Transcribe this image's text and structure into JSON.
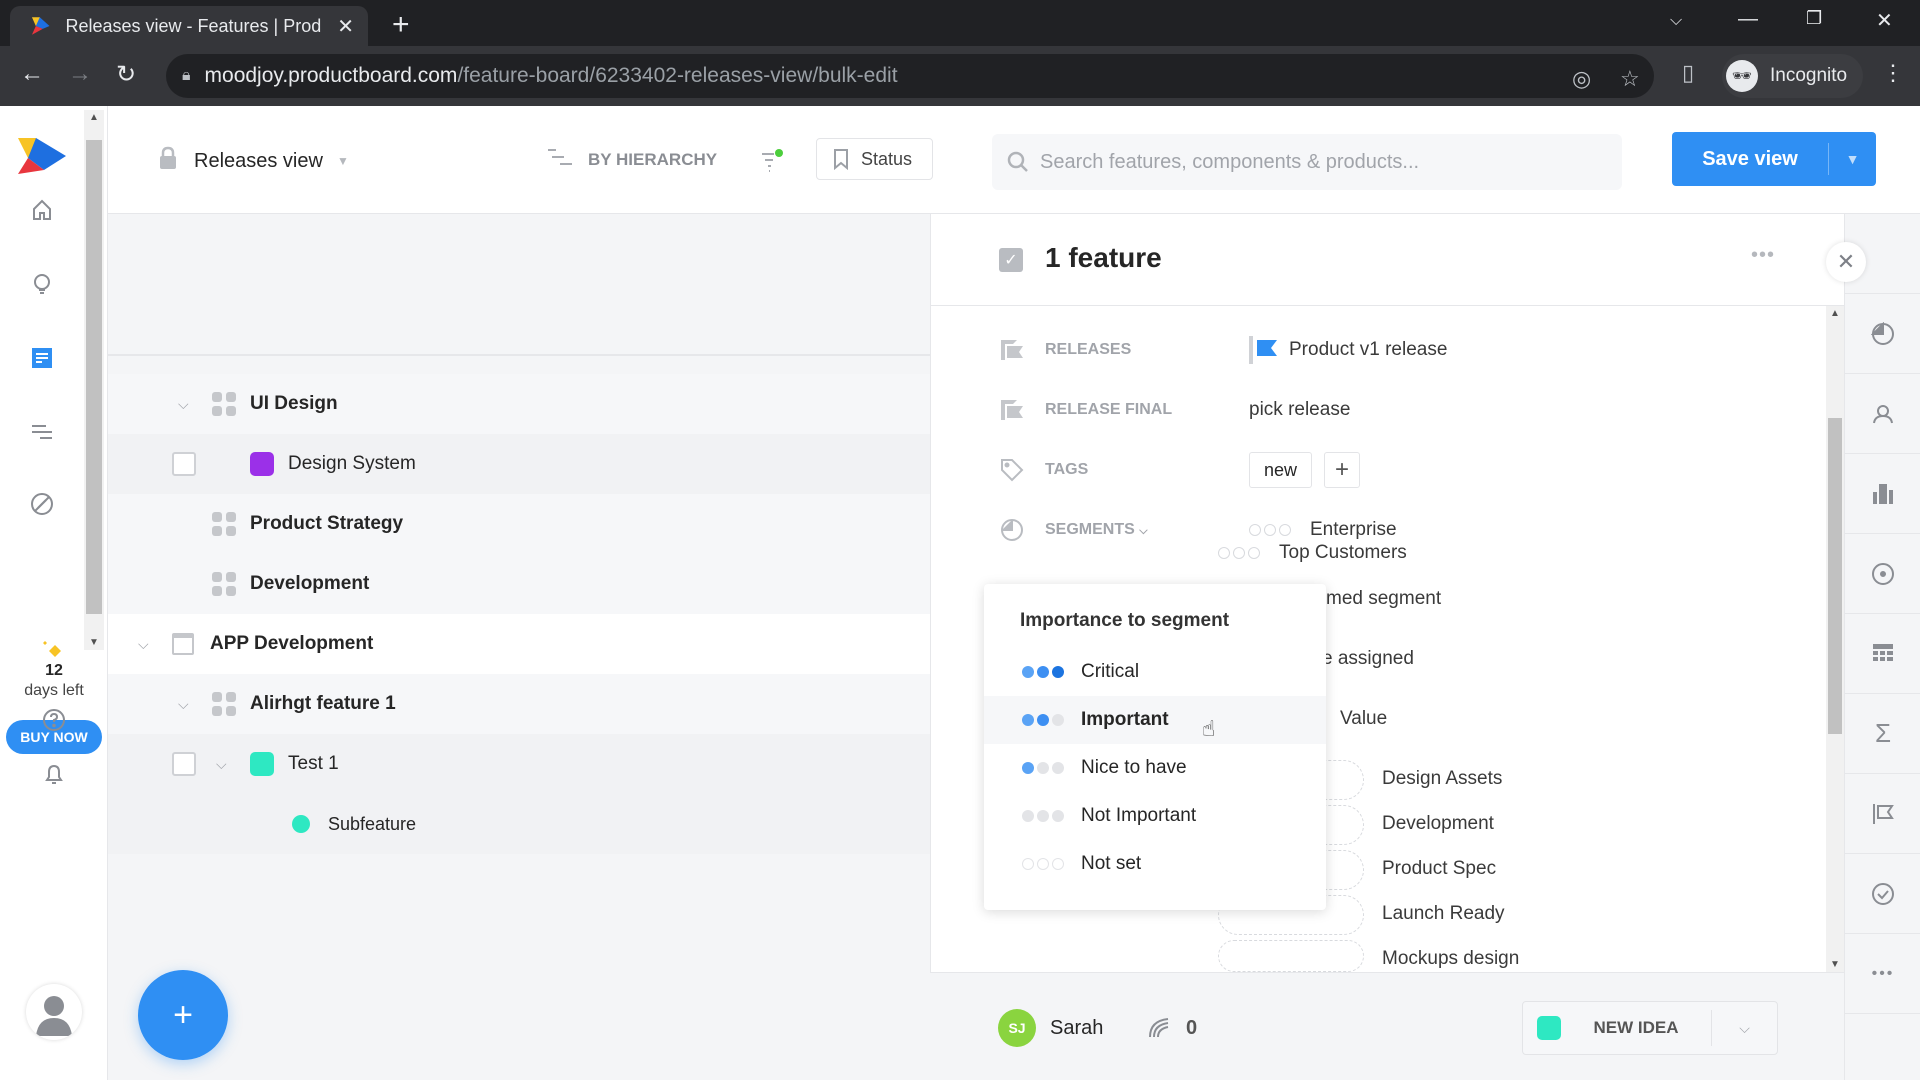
{
  "browser": {
    "tab_title": "Releases view - Features | Productboard",
    "url_host": "moodjoy.productboard.com",
    "url_path": "/feature-board/6233402-releases-view/bulk-edit",
    "profile_label": "Incognito"
  },
  "rail": {
    "trial_days": "12",
    "trial_label": "days left",
    "buy_now": "BUY NOW"
  },
  "appbar": {
    "view_name": "Releases view",
    "grouping": "BY HIERARCHY",
    "status_button": "Status",
    "search_placeholder": "Search features, components & products...",
    "save_view": "Save view"
  },
  "tree": {
    "rows": [
      {
        "label": "UI Design",
        "type": "component",
        "expanded": true
      },
      {
        "label": "Design System",
        "type": "feature",
        "color": "#9b30e8"
      },
      {
        "label": "Product Strategy",
        "type": "component"
      },
      {
        "label": "Development",
        "type": "component"
      },
      {
        "label": "APP Development",
        "type": "product",
        "expanded": true
      },
      {
        "label": "Alirhgt feature 1",
        "type": "component",
        "expanded": true
      },
      {
        "label": "Test 1",
        "type": "feature",
        "color": "#2ee8c2",
        "expanded": true
      },
      {
        "label": "Subfeature",
        "type": "subfeature",
        "color": "#2ee8c2"
      }
    ]
  },
  "detail": {
    "title": "1 feature",
    "properties": {
      "releases": {
        "label": "RELEASES",
        "value": "Product v1 release"
      },
      "release_final": {
        "label": "RELEASE FINAL",
        "value": "pick release"
      },
      "tags": {
        "label": "TAGS",
        "values": [
          "new"
        ]
      },
      "segments": {
        "label": "SEGMENTS"
      }
    },
    "segments": [
      {
        "name": "Enterprise",
        "importance": "Not set"
      },
      {
        "name": "Top Customers",
        "importance": "Not set"
      },
      {
        "name": "med segment"
      },
      {
        "name": "e assigned"
      }
    ],
    "value_label": "Value",
    "objectives": [
      "Design Assets",
      "Development",
      "Product Spec",
      "Launch Ready",
      "Mockups design"
    ],
    "footer": {
      "owner_initials": "SJ",
      "owner_name": "Sarah",
      "insights_count": "0",
      "status": "NEW IDEA",
      "status_color": "#2ee8c2"
    }
  },
  "popover": {
    "title": "Importance to segment",
    "options": [
      {
        "label": "Critical",
        "level": 3
      },
      {
        "label": "Important",
        "level": 2,
        "hovered": true
      },
      {
        "label": "Nice to have",
        "level": 1
      },
      {
        "label": "Not Important",
        "level": 0
      },
      {
        "label": "Not set",
        "level": -1
      }
    ]
  },
  "colors": {
    "accent": "#2f8ff3",
    "feature_purple": "#9b30e8",
    "feature_teal": "#2ee8c2",
    "avatar_green": "#8ad43f"
  }
}
